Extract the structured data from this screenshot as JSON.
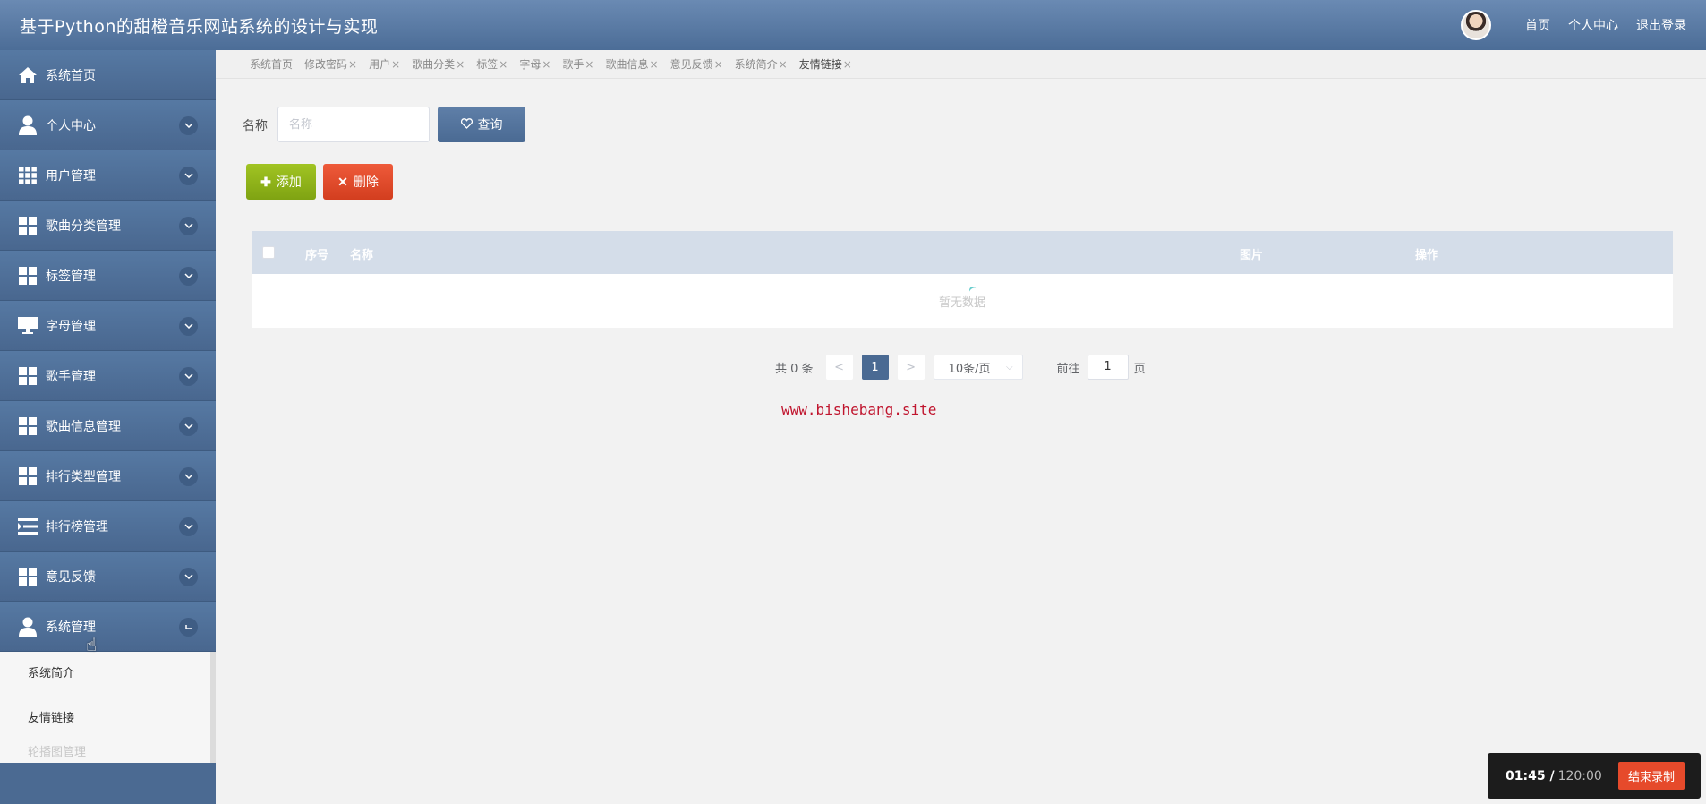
{
  "header": {
    "title": "基于Python的甜橙音乐网站系统的设计与实现",
    "links": [
      "首页",
      "个人中心",
      "退出登录"
    ]
  },
  "sidebar": {
    "items": [
      {
        "label": "系统首页",
        "icon": "home-icon"
      },
      {
        "label": "个人中心",
        "icon": "user-icon"
      },
      {
        "label": "用户管理",
        "icon": "grid-icon"
      },
      {
        "label": "歌曲分类管理",
        "icon": "tiles-icon"
      },
      {
        "label": "标签管理",
        "icon": "tiles-icon"
      },
      {
        "label": "字母管理",
        "icon": "monitor-icon"
      },
      {
        "label": "歌手管理",
        "icon": "tiles-icon"
      },
      {
        "label": "歌曲信息管理",
        "icon": "tiles-icon"
      },
      {
        "label": "排行类型管理",
        "icon": "tiles-icon"
      },
      {
        "label": "排行榜管理",
        "icon": "list-icon"
      },
      {
        "label": "意见反馈",
        "icon": "tiles-icon"
      },
      {
        "label": "系统管理",
        "icon": "user-icon"
      }
    ],
    "submenu": [
      "系统简介",
      "友情链接",
      "轮播图管理"
    ]
  },
  "tabs": [
    {
      "label": "系统首页",
      "closable": false
    },
    {
      "label": "修改密码",
      "closable": true
    },
    {
      "label": "用户",
      "closable": true
    },
    {
      "label": "歌曲分类",
      "closable": true
    },
    {
      "label": "标签",
      "closable": true
    },
    {
      "label": "字母",
      "closable": true
    },
    {
      "label": "歌手",
      "closable": true
    },
    {
      "label": "歌曲信息",
      "closable": true
    },
    {
      "label": "意见反馈",
      "closable": true
    },
    {
      "label": "系统简介",
      "closable": true
    },
    {
      "label": "友情链接",
      "closable": true
    }
  ],
  "search": {
    "label": "名称",
    "placeholder": "名称",
    "query_button": "查询"
  },
  "actions": {
    "add": "添加",
    "delete": "删除"
  },
  "table": {
    "columns": [
      "序号",
      "名称",
      "图片",
      "操作"
    ],
    "empty_text": "暂无数据"
  },
  "pager": {
    "total": "共 0 条",
    "prev": "<",
    "current": "1",
    "next": ">",
    "page_size": "10条/页",
    "goto_label": "前往",
    "goto_value": "1",
    "page_unit": "页"
  },
  "watermark": "www.bishebang.site",
  "recorder": {
    "elapsed": "01:45 /",
    "total": "120:00",
    "stop": "结束录制"
  }
}
